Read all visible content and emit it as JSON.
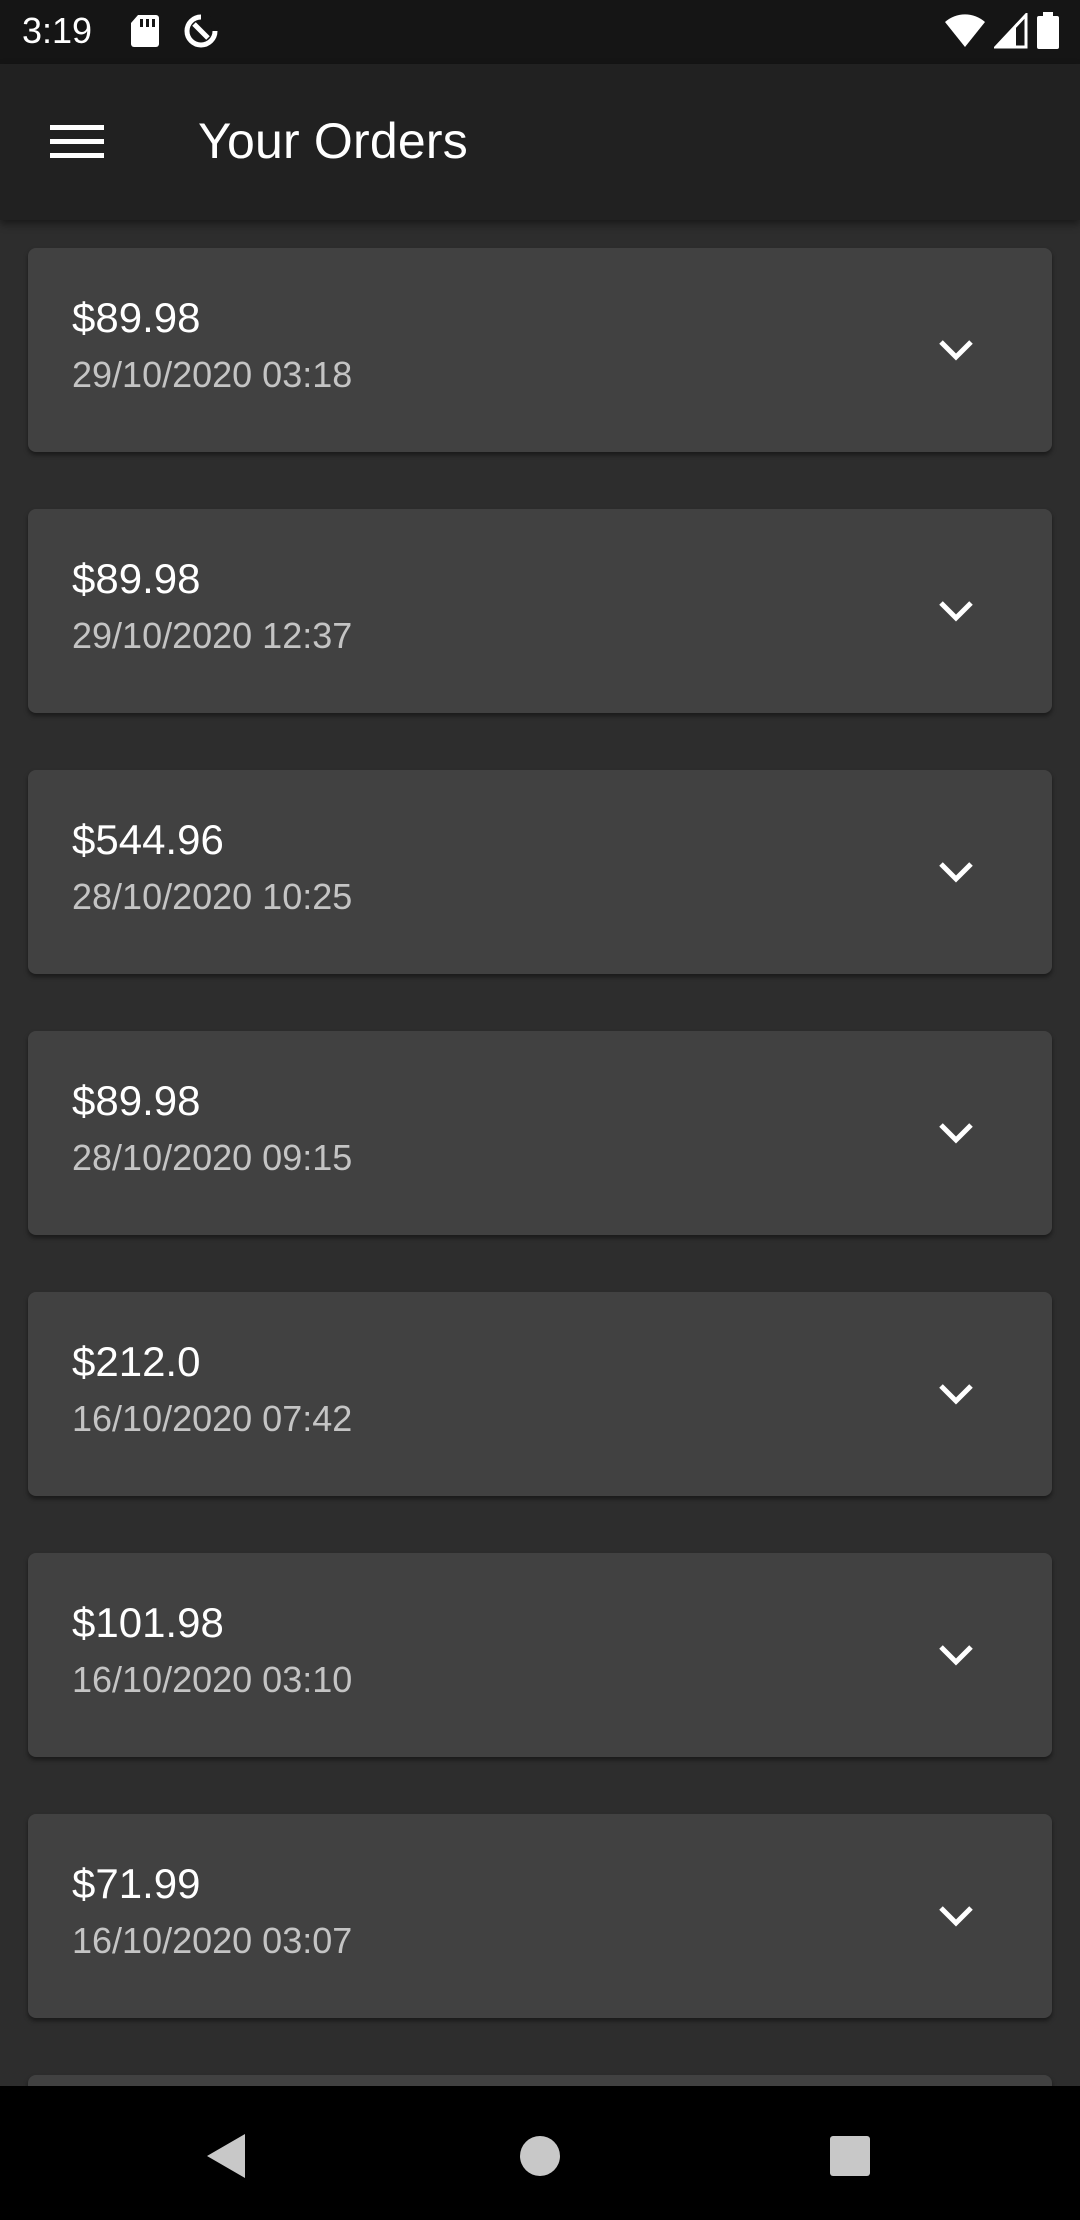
{
  "status_bar": {
    "time": "3:19",
    "icons": [
      "sd-card-icon",
      "data-saver-icon",
      "wifi-icon",
      "cell-signal-icon",
      "battery-icon"
    ]
  },
  "app_bar": {
    "title": "Your Orders",
    "menu_icon": "hamburger-menu-icon"
  },
  "orders": [
    {
      "total": "$89.98",
      "date": "29/10/2020 03:18"
    },
    {
      "total": "$89.98",
      "date": "29/10/2020 12:37"
    },
    {
      "total": "$544.96",
      "date": "28/10/2020 10:25"
    },
    {
      "total": "$89.98",
      "date": "28/10/2020 09:15"
    },
    {
      "total": "$212.0",
      "date": "16/10/2020 07:42"
    },
    {
      "total": "$101.98",
      "date": "16/10/2020 03:10"
    },
    {
      "total": "$71.99",
      "date": "16/10/2020 03:07"
    }
  ],
  "nav_bar": {
    "icons": [
      "back-icon",
      "home-icon",
      "recents-icon"
    ]
  },
  "colors": {
    "background": "#2d2d2d",
    "app_bar": "#212121",
    "card": "#414141",
    "status_bar": "#151515",
    "nav_bar": "#000000",
    "date_text": "#c4c4c4"
  }
}
